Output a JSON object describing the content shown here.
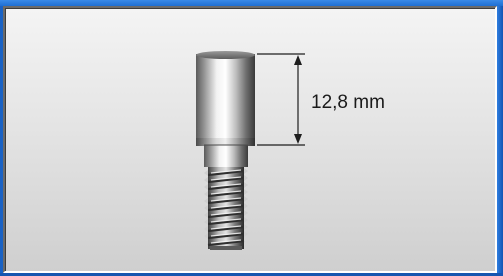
{
  "viewer": {
    "dimension_label": "12,8 mm"
  },
  "colors": {
    "frame_blue": "#1a6ccd",
    "panel_top": "#f4f4f4",
    "panel_bottom": "#cfcfcf",
    "dimension_line": "#1e1e1e"
  }
}
